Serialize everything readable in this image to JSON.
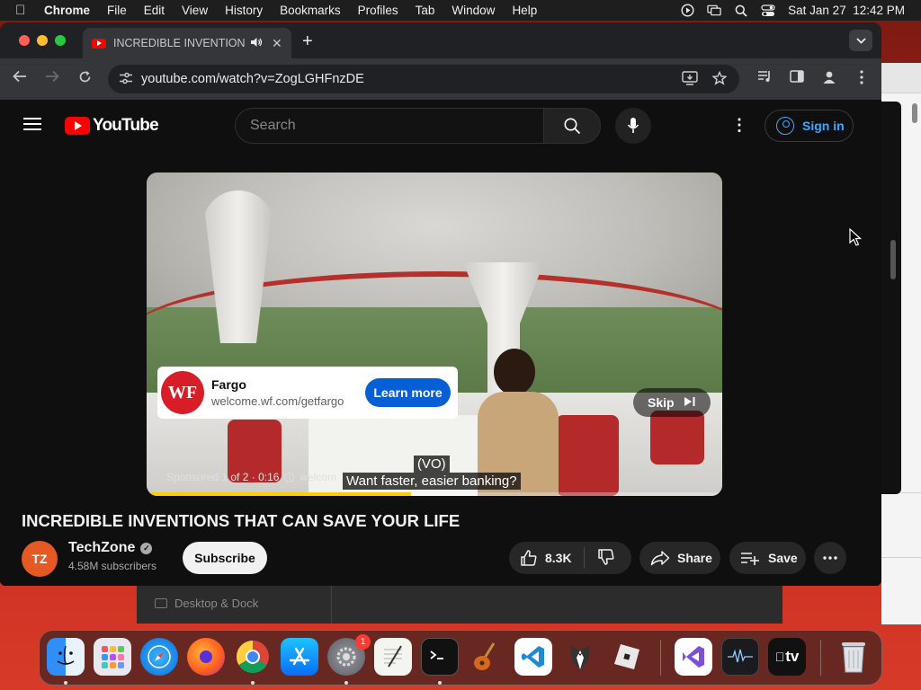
{
  "menubar": {
    "app": "Chrome",
    "items": [
      "File",
      "Edit",
      "View",
      "History",
      "Bookmarks",
      "Profiles",
      "Tab",
      "Window",
      "Help"
    ],
    "datetime": "Sat Jan 27  12:42 PM"
  },
  "chrome": {
    "tab_title": "INCREDIBLE INVENTIONS",
    "url": "youtube.com/watch?v=ZogLGHFnzDE"
  },
  "youtube": {
    "logo_text": "YouTube",
    "search_placeholder": "Search",
    "sign_in": "Sign in"
  },
  "ad": {
    "advertiser": "Fargo",
    "logo_text": "WF",
    "url": "welcome.wf.com/getfargo",
    "cta": "Learn more",
    "skip": "Skip",
    "sponsored": "Sponsored 1 of 2 · 0:16",
    "domain_snippet": "welcom",
    "caption_line1": "(VO)",
    "caption_line2": "Want faster, easier banking?",
    "progress_percent": 46
  },
  "video": {
    "title": "INCREDIBLE INVENTIONS THAT CAN SAVE YOUR LIFE",
    "channel": "TechZone",
    "channel_avatar": "TZ",
    "subscribers": "4.58M subscribers",
    "subscribe": "Subscribe",
    "likes": "8.3K",
    "share": "Share",
    "save": "Save"
  },
  "background_window": {
    "sidebar_item": "Desktop & Dock"
  },
  "dock": {
    "items": [
      "finder-icon",
      "launchpad-icon",
      "safari-icon",
      "firefox-icon",
      "chrome-icon",
      "app-store-icon",
      "system-settings-icon",
      "textedit-icon",
      "terminal-icon",
      "garageband-icon",
      "vscode-icon",
      "alfred-icon",
      "roblox-icon",
      "visual-studio-icon",
      "activity-monitor-icon",
      "apple-tv-icon",
      "trash-icon"
    ],
    "settings_badge": "1",
    "tv_label": "tv"
  }
}
